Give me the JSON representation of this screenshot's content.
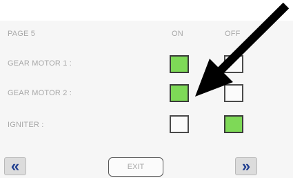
{
  "header": {
    "page_label": "PAGE 5",
    "on_label": "ON",
    "off_label": "OFF"
  },
  "rows": [
    {
      "label": "GEAR MOTOR 1 :",
      "on": true,
      "off": false
    },
    {
      "label": "GEAR MOTOR 2 :",
      "on": true,
      "off": false
    },
    {
      "label": "IGNITER :",
      "on": false,
      "off": true
    }
  ],
  "footer": {
    "prev_icon": "«",
    "exit_label": "EXIT",
    "next_icon": "»"
  },
  "colors": {
    "active_fill": "#7ed957",
    "nav_arrow": "#1f3d8f",
    "annotation_arrow": "#000000"
  },
  "icons": {
    "prev": "double-chevron-left-icon",
    "next": "double-chevron-right-icon",
    "annotation": "arrow-icon"
  }
}
